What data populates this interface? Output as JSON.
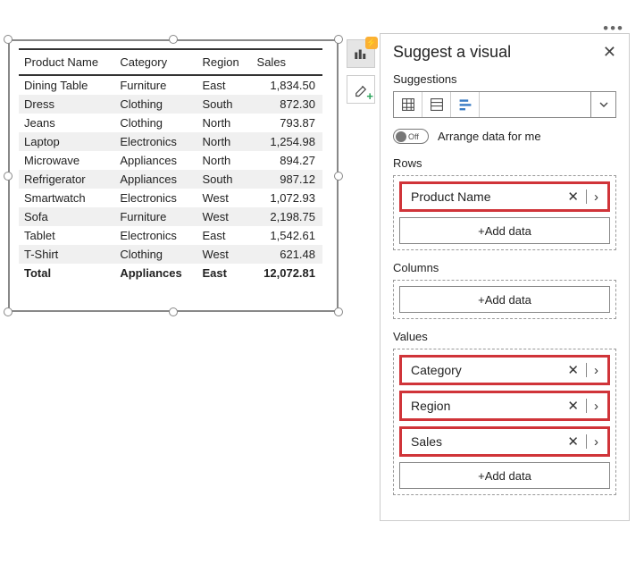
{
  "visual_toolbar": {
    "filter_icon": "filter-icon",
    "popout_icon": "popout-icon",
    "more_icon": "more-icon"
  },
  "table": {
    "headers": [
      "Product Name",
      "Category",
      "Region",
      "Sales"
    ],
    "rows": [
      {
        "product": "Dining Table",
        "category": "Furniture",
        "region": "East",
        "sales": "1,834.50"
      },
      {
        "product": "Dress",
        "category": "Clothing",
        "region": "South",
        "sales": "872.30"
      },
      {
        "product": "Jeans",
        "category": "Clothing",
        "region": "North",
        "sales": "793.87"
      },
      {
        "product": "Laptop",
        "category": "Electronics",
        "region": "North",
        "sales": "1,254.98"
      },
      {
        "product": "Microwave",
        "category": "Appliances",
        "region": "North",
        "sales": "894.27"
      },
      {
        "product": "Refrigerator",
        "category": "Appliances",
        "region": "South",
        "sales": "987.12"
      },
      {
        "product": "Smartwatch",
        "category": "Electronics",
        "region": "West",
        "sales": "1,072.93"
      },
      {
        "product": "Sofa",
        "category": "Furniture",
        "region": "West",
        "sales": "2,198.75"
      },
      {
        "product": "Tablet",
        "category": "Electronics",
        "region": "East",
        "sales": "1,542.61"
      },
      {
        "product": "T-Shirt",
        "category": "Clothing",
        "region": "West",
        "sales": "621.48"
      }
    ],
    "total": {
      "label": "Total",
      "category": "Appliances",
      "region": "East",
      "sales": "12,072.81"
    }
  },
  "pane": {
    "title": "Suggest a visual",
    "suggestions_label": "Suggestions",
    "arrange_toggle_state": "Off",
    "arrange_label": "Arrange data for me",
    "rows_label": "Rows",
    "columns_label": "Columns",
    "values_label": "Values",
    "add_data_label": "+Add data",
    "rows_fields": [
      "Product Name"
    ],
    "columns_fields": [],
    "values_fields": [
      "Category",
      "Region",
      "Sales"
    ]
  }
}
